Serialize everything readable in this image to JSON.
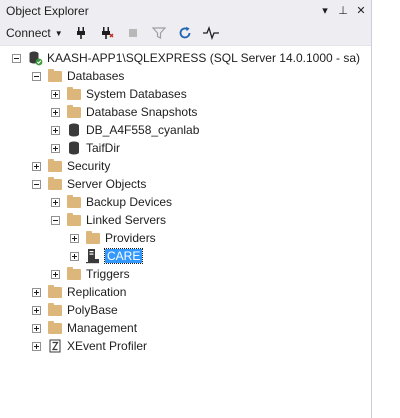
{
  "panel": {
    "title": "Object Explorer",
    "controls": {
      "dropdown": "▾",
      "pin": "⊥",
      "close": "✕"
    }
  },
  "toolbar": {
    "connect_label": "Connect"
  },
  "tree": {
    "server": "KAASH-APP1\\SQLEXPRESS (SQL Server 14.0.1000 - sa)",
    "databases": "Databases",
    "system_databases": "System Databases",
    "database_snapshots": "Database Snapshots",
    "db1": "DB_A4F558_cyanlab",
    "db2": "TaifDir",
    "security": "Security",
    "server_objects": "Server Objects",
    "backup_devices": "Backup Devices",
    "linked_servers": "Linked Servers",
    "providers": "Providers",
    "care": "CARE",
    "triggers": "Triggers",
    "replication": "Replication",
    "polybase": "PolyBase",
    "management": "Management",
    "xevent_profiler": "XEvent Profiler"
  },
  "colors": {
    "selection": "#3399ff",
    "folder": "#dcb67a",
    "titlebar": "#eeeef2"
  }
}
